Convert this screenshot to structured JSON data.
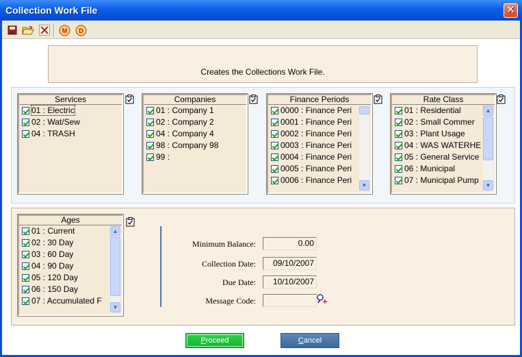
{
  "window": {
    "title": "Collection Work File",
    "close_glyph": "✕"
  },
  "toolbar": {
    "icons": [
      "save-icon",
      "open-folder-icon",
      "delete-icon",
      "m-circle-icon",
      "d-circle-icon"
    ],
    "m_glyph": "M",
    "d_glyph": "D"
  },
  "description": "Creates the Collections Work File.",
  "services": {
    "header": "Services",
    "items": [
      "01 : Electric",
      "02 : Wat/Sew",
      "04 : TRASH"
    ]
  },
  "companies": {
    "header": "Companies",
    "items": [
      "01 : Company 1",
      "02 : Company 2",
      "04 : Company 4",
      "98 : Company 98",
      "99 :"
    ]
  },
  "finance_periods": {
    "header": "Finance Periods",
    "items": [
      "0000 : Finance Peri",
      "0001 : Finance Peri",
      "0002 : Finance Peri",
      "0003 : Finance Peri",
      "0004 : Finance Peri",
      "0005 : Finance Peri",
      "0006 : Finance Peri"
    ]
  },
  "rate_class": {
    "header": "Rate Class",
    "items": [
      "01 : Residential",
      "02 : Small Commer",
      "03 : Plant Usage",
      "04 : WAS WATERHE",
      "05 : General Service",
      "06 : Municipal",
      "07 : Municipal Pump"
    ]
  },
  "ages": {
    "header": "Ages",
    "items": [
      "01 : Current",
      "02 : 30 Day",
      "03 : 60 Day",
      "04 : 90 Day",
      "05 : 120 Day",
      "06 : 150 Day",
      "07 : Accumulated F"
    ]
  },
  "form": {
    "min_balance_label": "Minimum Balance:",
    "min_balance_value": "0.00",
    "collection_date_label": "Collection Date:",
    "collection_date_value": "09/10/2007",
    "due_date_label": "Due Date:",
    "due_date_value": "10/10/2007",
    "message_code_label": "Message Code:",
    "message_code_value": ""
  },
  "buttons": {
    "proceed_accel": "P",
    "proceed_rest": "roceed",
    "cancel_accel": "C",
    "cancel_rest": "ancel"
  },
  "colors": {
    "proceed": "#14b22e",
    "cancel": "#3d6a9c",
    "titlebar": "#0a5fe8"
  }
}
